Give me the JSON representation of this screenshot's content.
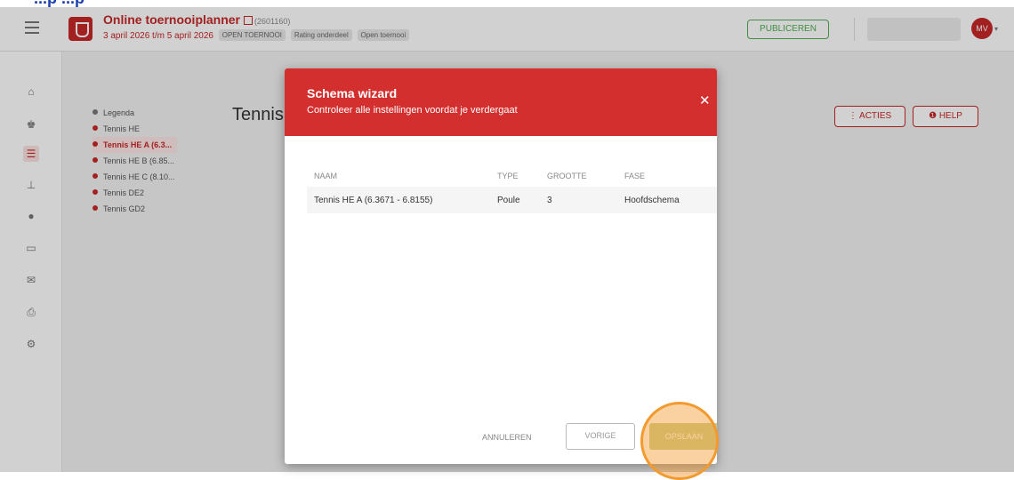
{
  "header": {
    "title": "Online toernooiplanner",
    "id": "(2601160)",
    "dates": "3 april 2026 t/m 5 april 2026",
    "chips": [
      "OPEN TOERNOOI",
      "Rating onderdeel",
      "Open toernooi"
    ],
    "publish_label": "PUBLICEREN",
    "avatar_initials": "MV"
  },
  "top_fragment": "...p ...p",
  "nav_icons": [
    "home-icon",
    "trophy-icon",
    "list-icon",
    "bracket-icon",
    "ball-icon",
    "monitor-icon",
    "mail-icon",
    "print-icon",
    "gear-icon"
  ],
  "legend": {
    "items": [
      "Legenda",
      "Tennis HE",
      "Tennis HE A (6.3...",
      "Tennis HE B (6.85...",
      "Tennis HE C (8.10...",
      "Tennis DE2",
      "Tennis GD2"
    ]
  },
  "page": {
    "title": "Tennis",
    "actions_label": "⋮ ACTIES",
    "help_label": "HELP"
  },
  "modal": {
    "title": "Schema wizard",
    "subtitle": "Controleer alle instellingen voordat je verdergaat",
    "columns": [
      "NAAM",
      "TYPE",
      "GROOTTE",
      "FASE"
    ],
    "rows": [
      [
        "Tennis HE A (6.3671 - 6.8155)",
        "Poule",
        "3",
        "Hoofdschema"
      ]
    ],
    "cancel_label": "ANNULEREN",
    "prev_label": "VORIGE",
    "save_label": "OPSLAAN"
  },
  "colors": {
    "brand": "#c62828",
    "publish": "#4caf50",
    "highlight": "#f39a2e"
  }
}
